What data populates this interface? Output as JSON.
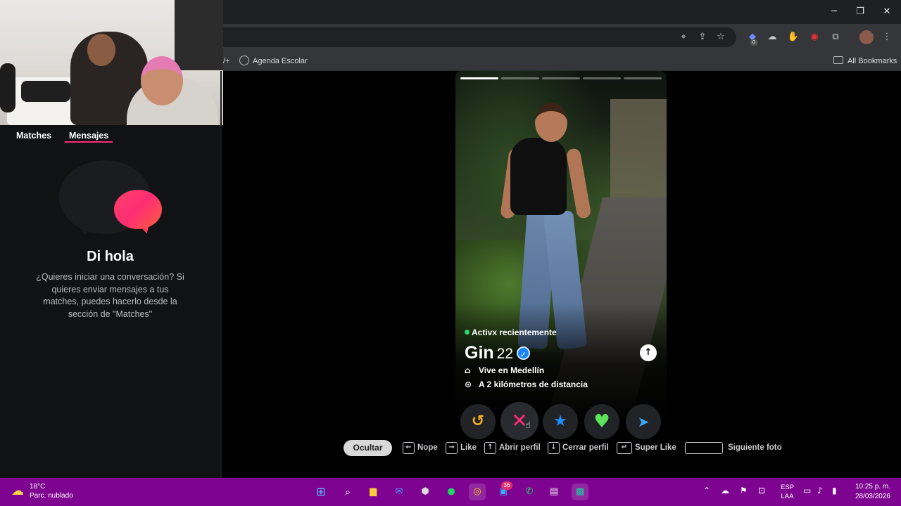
{
  "browser": {
    "controls": {
      "minimize": "─",
      "maximize": "❐",
      "close": "✕"
    },
    "bookmarks": [
      {
        "label": "Agenda Escolar",
        "icon": "globe-icon"
      }
    ],
    "bookmark_prefix": "/+",
    "all_bookmarks": "All Bookmarks",
    "extension_badge": "0"
  },
  "left_panel": {
    "tabs": [
      {
        "label": "Matches",
        "active": false
      },
      {
        "label": "Mensajes",
        "active": true
      }
    ],
    "empty_state": {
      "title": "Di hola",
      "text": "¿Quieres iniciar una conversación? Si quieres enviar mensajes a tus matches, puedes hacerlo desde la sección de \"Matches\""
    }
  },
  "profile": {
    "photo_count": 5,
    "active_photo": 1,
    "status": "Activx recientemente",
    "name": "Gin",
    "age": "22",
    "verified": true,
    "lives_in": "Vive en Medellín",
    "distance": "A 2 kilómetros de distancia"
  },
  "actions": {
    "rewind": "↺",
    "nope": "✕",
    "superlike": "★",
    "like": "♥",
    "boost": "➤"
  },
  "shortcuts": {
    "hide": "Ocultar",
    "items": [
      {
        "key": "←",
        "label": "Nope"
      },
      {
        "key": "→",
        "label": "Like"
      },
      {
        "key": "↑",
        "label": "Abrir perfil"
      },
      {
        "key": "↓",
        "label": "Cerrar perfil"
      },
      {
        "key": "↵",
        "label": "Super Like"
      },
      {
        "key": "",
        "label": "Siguiente foto"
      }
    ]
  },
  "taskbar": {
    "weather_temp": "18°C",
    "weather_desc": "Parc. nublado",
    "badge_count": "36",
    "lang_top": "ESP",
    "lang_bottom": "LAA",
    "time": "10:25 p. m.",
    "date": "28/03/2026"
  },
  "colors": {
    "accent": "#fd2d74",
    "taskbar": "#7e0391",
    "online": "#2ed573",
    "verified": "#1786f8"
  }
}
